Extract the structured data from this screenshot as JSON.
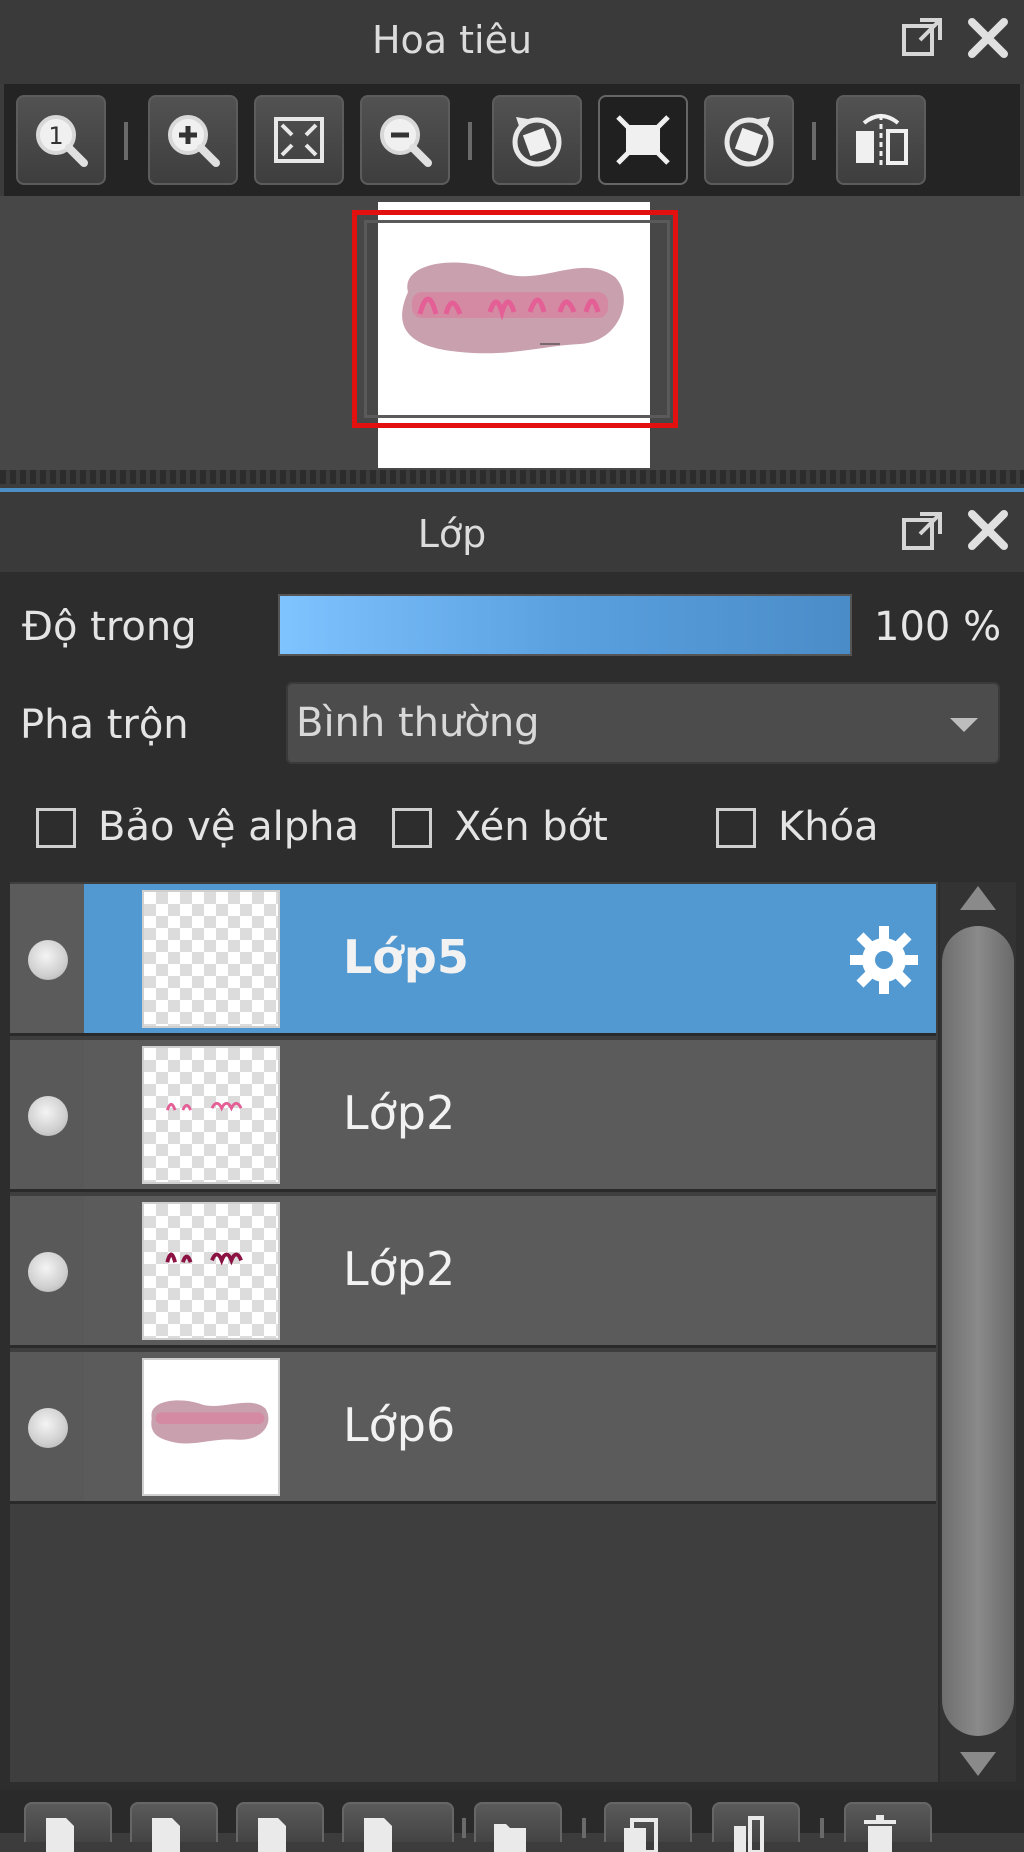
{
  "navigator": {
    "title": "Hoa tiêu",
    "toolbar": [
      {
        "name": "zoom-actual-size",
        "icon": "zoom-1to1-icon"
      },
      {
        "name": "zoom-in",
        "icon": "zoom-in-icon"
      },
      {
        "name": "fit-to-window",
        "icon": "fit-screen-icon"
      },
      {
        "name": "zoom-out",
        "icon": "zoom-out-icon"
      },
      {
        "name": "rotate-left",
        "icon": "rotate-left-icon"
      },
      {
        "name": "reset-view",
        "icon": "reset-rotation-icon",
        "active": true
      },
      {
        "name": "rotate-right",
        "icon": "rotate-right-icon"
      },
      {
        "name": "flip-horizontal",
        "icon": "flip-horizontal-icon"
      }
    ]
  },
  "layers_panel": {
    "title": "Lớp",
    "opacity": {
      "label": "Độ trong",
      "value": "100 %",
      "level_percent": 100
    },
    "blend": {
      "label": "Pha trộn",
      "value": "Bình thường"
    },
    "checkboxes": [
      {
        "label": "Bảo vệ alpha",
        "checked": false
      },
      {
        "label": "Xén bớt",
        "checked": false
      },
      {
        "label": "Khóa",
        "checked": false
      }
    ],
    "layers": [
      {
        "name": "Lớp5",
        "selected": true,
        "visible": true
      },
      {
        "name": "Lớp2",
        "selected": false,
        "visible": true
      },
      {
        "name": "Lớp2",
        "selected": false,
        "visible": true
      },
      {
        "name": "Lớp6",
        "selected": false,
        "visible": true
      }
    ]
  },
  "colors": {
    "accent": "#5399d1",
    "frame": "#e31010",
    "panel_bg": "#3a3a3a"
  }
}
